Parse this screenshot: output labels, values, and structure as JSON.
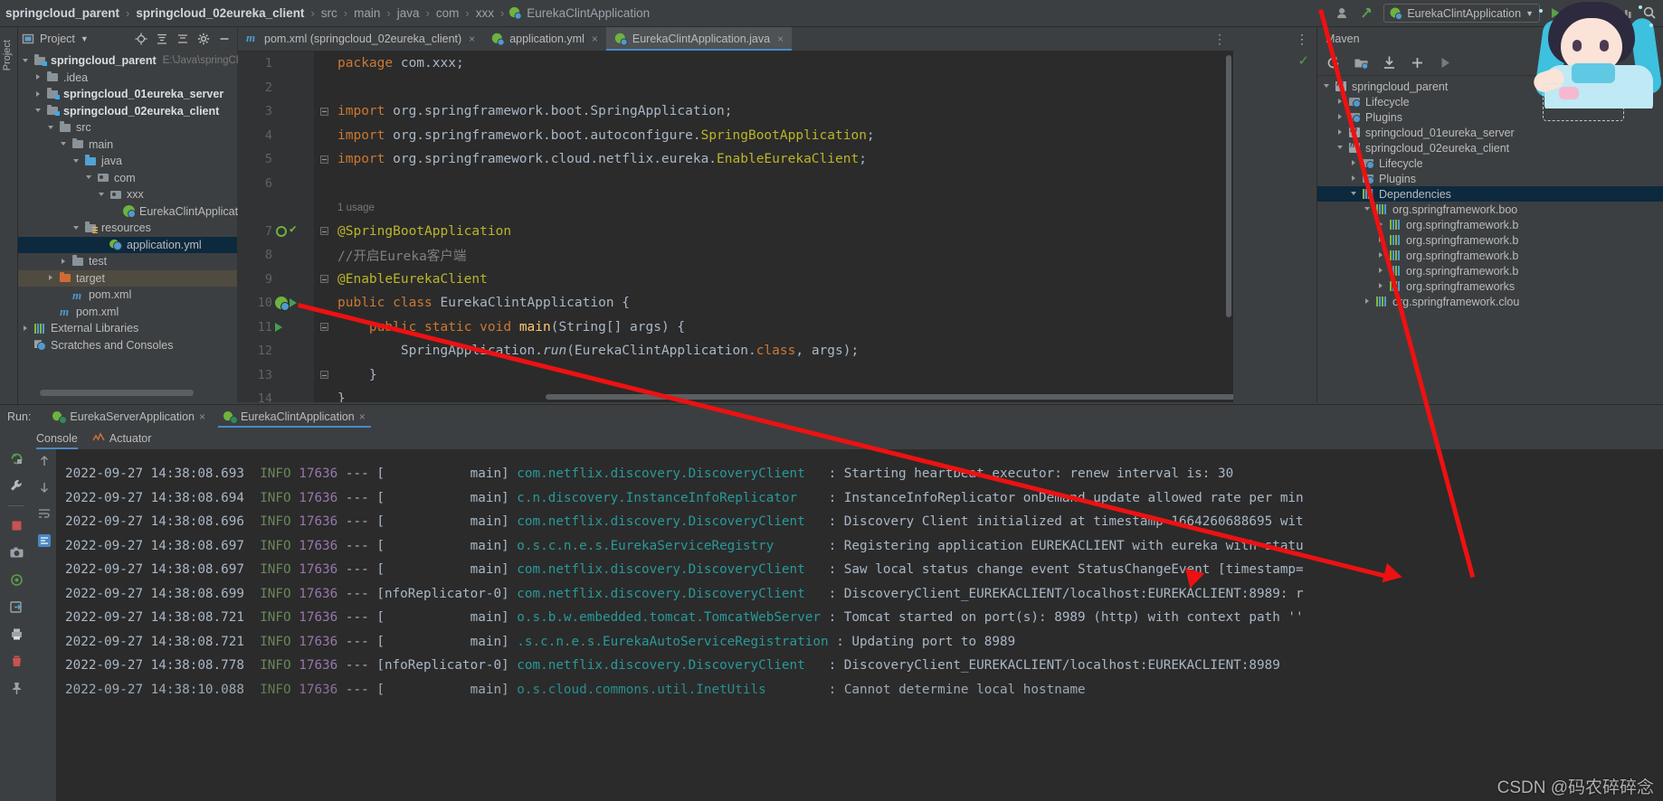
{
  "breadcrumb": {
    "items": [
      {
        "label": "springcloud_parent",
        "bold": true
      },
      {
        "label": "springcloud_02eureka_client",
        "bold": true
      },
      {
        "label": "src",
        "bold": false
      },
      {
        "label": "main",
        "bold": false
      },
      {
        "label": "java",
        "bold": false
      },
      {
        "label": "com",
        "bold": false
      },
      {
        "label": "xxx",
        "bold": false
      },
      {
        "label": "EurekaClintApplication",
        "bold": false
      }
    ],
    "separator": "›"
  },
  "toolbar": {
    "run_config_label": "EurekaClintApplication",
    "icons": [
      "account-icon",
      "dropdown-icon",
      "update-project-icon",
      "run-icon",
      "debug-icon",
      "coverage-icon",
      "profiler-icon",
      "search-icon"
    ]
  },
  "left_rail": {
    "tabs": [
      "Project"
    ]
  },
  "project_panel": {
    "title": "Project",
    "header_icons": [
      "locate-icon",
      "expand-all-icon",
      "collapse-all-icon",
      "settings-icon",
      "hide-icon"
    ],
    "tree": [
      {
        "label": "springcloud_parent",
        "indent": 0,
        "arrow": "down",
        "icon": "module-folder",
        "bold": true,
        "path": "E:\\Java\\springCloud\\s",
        "state": "none"
      },
      {
        "label": ".idea",
        "indent": 1,
        "arrow": "right",
        "icon": "folder",
        "bold": false,
        "path": "",
        "state": "none"
      },
      {
        "label": "springcloud_01eureka_server",
        "indent": 1,
        "arrow": "right",
        "icon": "module-folder",
        "bold": true,
        "path": "",
        "state": "none"
      },
      {
        "label": "springcloud_02eureka_client",
        "indent": 1,
        "arrow": "down",
        "icon": "module-folder",
        "bold": true,
        "path": "",
        "state": "none"
      },
      {
        "label": "src",
        "indent": 2,
        "arrow": "down",
        "icon": "folder",
        "bold": false,
        "path": "",
        "state": "none"
      },
      {
        "label": "main",
        "indent": 3,
        "arrow": "down",
        "icon": "folder",
        "bold": false,
        "path": "",
        "state": "none"
      },
      {
        "label": "java",
        "indent": 4,
        "arrow": "down",
        "icon": "source-folder",
        "bold": false,
        "path": "",
        "state": "none"
      },
      {
        "label": "com",
        "indent": 5,
        "arrow": "down",
        "icon": "package",
        "bold": false,
        "path": "",
        "state": "none"
      },
      {
        "label": "xxx",
        "indent": 6,
        "arrow": "down",
        "icon": "package",
        "bold": false,
        "path": "",
        "state": "none"
      },
      {
        "label": "EurekaClintApplication",
        "indent": 7,
        "arrow": "none",
        "icon": "spring-class",
        "bold": false,
        "path": "",
        "state": "none"
      },
      {
        "label": "resources",
        "indent": 4,
        "arrow": "down",
        "icon": "resource-folder",
        "bold": false,
        "path": "",
        "state": "none"
      },
      {
        "label": "application.yml",
        "indent": 6,
        "arrow": "none",
        "icon": "spring-yml",
        "bold": false,
        "path": "",
        "state": "selected-blue"
      },
      {
        "label": "test",
        "indent": 3,
        "arrow": "right",
        "icon": "folder",
        "bold": false,
        "path": "",
        "state": "none"
      },
      {
        "label": "target",
        "indent": 2,
        "arrow": "right",
        "icon": "target-folder",
        "bold": false,
        "path": "",
        "state": "selected-brown"
      },
      {
        "label": "pom.xml",
        "indent": 3,
        "arrow": "none",
        "icon": "maven-file",
        "bold": false,
        "path": "",
        "state": "none"
      },
      {
        "label": "pom.xml",
        "indent": 2,
        "arrow": "none",
        "icon": "maven-file",
        "bold": false,
        "path": "",
        "state": "none"
      },
      {
        "label": "External Libraries",
        "indent": 0,
        "arrow": "right",
        "icon": "library",
        "bold": false,
        "path": "",
        "state": "none"
      },
      {
        "label": "Scratches and Consoles",
        "indent": 0,
        "arrow": "none",
        "icon": "scratches",
        "bold": false,
        "path": "",
        "state": "none"
      }
    ]
  },
  "editor": {
    "tabs": [
      {
        "label": "pom.xml (springcloud_02eureka_client)",
        "icon": "maven-file",
        "active": false,
        "closable": true
      },
      {
        "label": "application.yml",
        "icon": "spring-yml",
        "active": false,
        "closable": true
      },
      {
        "label": "EurekaClintApplication.java",
        "icon": "spring-class",
        "active": true,
        "closable": true
      }
    ],
    "lines": [
      {
        "num": "1",
        "gutter": [],
        "fold": "none",
        "segments": [
          {
            "t": "package",
            "c": "k"
          },
          {
            "t": " com.xxx;",
            "c": "p"
          }
        ]
      },
      {
        "num": "2",
        "gutter": [],
        "fold": "none",
        "segments": []
      },
      {
        "num": "3",
        "gutter": [],
        "fold": "start",
        "segments": [
          {
            "t": "import",
            "c": "k"
          },
          {
            "t": " org.springframework.boot.SpringApplication;",
            "c": "p"
          }
        ]
      },
      {
        "num": "4",
        "gutter": [],
        "fold": "none",
        "segments": [
          {
            "t": "import",
            "c": "k"
          },
          {
            "t": " org.springframework.boot.autoconfigure.",
            "c": "p"
          },
          {
            "t": "SpringBootApplication",
            "c": "ann"
          },
          {
            "t": ";",
            "c": "p"
          }
        ]
      },
      {
        "num": "5",
        "gutter": [],
        "fold": "end",
        "segments": [
          {
            "t": "import",
            "c": "k"
          },
          {
            "t": " org.springframework.cloud.netflix.eureka.",
            "c": "p"
          },
          {
            "t": "EnableEurekaClient",
            "c": "ann"
          },
          {
            "t": ";",
            "c": "p"
          }
        ]
      },
      {
        "num": "6",
        "gutter": [],
        "fold": "none",
        "segments": []
      },
      {
        "num": "",
        "gutter": [],
        "fold": "none",
        "usage": "1 usage",
        "segments": []
      },
      {
        "num": "7",
        "gutter": [
          "search-icon",
          "check-icon"
        ],
        "fold": "start",
        "segments": [
          {
            "t": "@SpringBootApplication",
            "c": "ann"
          }
        ]
      },
      {
        "num": "8",
        "gutter": [],
        "fold": "none",
        "segments": [
          {
            "t": "//开启Eureka客户端",
            "c": "cmt"
          }
        ]
      },
      {
        "num": "9",
        "gutter": [],
        "fold": "end",
        "segments": [
          {
            "t": "@EnableEurekaClient",
            "c": "ann"
          }
        ]
      },
      {
        "num": "10",
        "gutter": [
          "spring-bean-icon",
          "run-arrow-icon"
        ],
        "fold": "none",
        "segments": [
          {
            "t": "public",
            "c": "k"
          },
          {
            "t": " ",
            "c": "p"
          },
          {
            "t": "class",
            "c": "k"
          },
          {
            "t": " EurekaClintApplication {",
            "c": "p"
          }
        ]
      },
      {
        "num": "11",
        "gutter": [
          "run-arrow-icon"
        ],
        "fold": "start",
        "segments": [
          {
            "t": "    ",
            "c": "p"
          },
          {
            "t": "public",
            "c": "k"
          },
          {
            "t": " ",
            "c": "p"
          },
          {
            "t": "static",
            "c": "k"
          },
          {
            "t": " ",
            "c": "p"
          },
          {
            "t": "void",
            "c": "k"
          },
          {
            "t": " ",
            "c": "p"
          },
          {
            "t": "main",
            "c": "fn"
          },
          {
            "t": "(String[] args) {",
            "c": "p"
          }
        ]
      },
      {
        "num": "12",
        "gutter": [],
        "fold": "none",
        "segments": [
          {
            "t": "        SpringApplication.",
            "c": "p"
          },
          {
            "t": "run",
            "c": "ital"
          },
          {
            "t": "(EurekaClintApplication.",
            "c": "p"
          },
          {
            "t": "class",
            "c": "k"
          },
          {
            "t": ", args);",
            "c": "p"
          }
        ]
      },
      {
        "num": "13",
        "gutter": [],
        "fold": "end",
        "segments": [
          {
            "t": "    }",
            "c": "p"
          }
        ]
      },
      {
        "num": "14",
        "gutter": [],
        "fold": "none",
        "segments": [
          {
            "t": "}",
            "c": "p"
          }
        ]
      }
    ]
  },
  "maven_panel": {
    "title": "Maven",
    "toolbar_icons": [
      "reload-icon",
      "add-module-icon",
      "download-sources-icon",
      "add-icon",
      "run-icon",
      "toggle-icon"
    ],
    "tree": [
      {
        "label": "springcloud_parent",
        "indent": 0,
        "arrow": "down",
        "icon": "maven-project",
        "state": "none"
      },
      {
        "label": "Lifecycle",
        "indent": 1,
        "arrow": "right",
        "icon": "phase-folder",
        "state": "none"
      },
      {
        "label": "Plugins",
        "indent": 1,
        "arrow": "right",
        "icon": "phase-folder",
        "state": "none"
      },
      {
        "label": "springcloud_01eureka_server",
        "indent": 1,
        "arrow": "right",
        "icon": "maven-project",
        "state": "none"
      },
      {
        "label": "springcloud_02eureka_client",
        "indent": 1,
        "arrow": "down",
        "icon": "maven-project",
        "state": "none"
      },
      {
        "label": "Lifecycle",
        "indent": 2,
        "arrow": "right",
        "icon": "phase-folder",
        "state": "none"
      },
      {
        "label": "Plugins",
        "indent": 2,
        "arrow": "right",
        "icon": "phase-folder",
        "state": "none"
      },
      {
        "label": "Dependencies",
        "indent": 2,
        "arrow": "down",
        "icon": "dependency",
        "state": "selected"
      },
      {
        "label": "org.springframework.boo",
        "indent": 3,
        "arrow": "down",
        "icon": "dependency",
        "state": "none"
      },
      {
        "label": "org.springframework.b",
        "indent": 4,
        "arrow": "right",
        "icon": "dependency",
        "state": "none"
      },
      {
        "label": "org.springframework.b",
        "indent": 4,
        "arrow": "right",
        "icon": "dependency",
        "state": "none"
      },
      {
        "label": "org.springframework.b",
        "indent": 4,
        "arrow": "right",
        "icon": "dependency",
        "state": "none"
      },
      {
        "label": "org.springframework.b",
        "indent": 4,
        "arrow": "right",
        "icon": "dependency",
        "state": "none"
      },
      {
        "label": "org.springframeworks",
        "indent": 4,
        "arrow": "right",
        "icon": "dependency",
        "state": "none"
      },
      {
        "label": "org.springframework.clou",
        "indent": 3,
        "arrow": "right",
        "icon": "dependency",
        "state": "none"
      }
    ]
  },
  "run_panel": {
    "run_label": "Run:",
    "tabs": [
      {
        "label": "EurekaServerApplication",
        "active": false,
        "closable": true
      },
      {
        "label": "EurekaClintApplication",
        "active": true,
        "closable": true
      }
    ],
    "sub_tabs": [
      {
        "label": "Console",
        "active": true,
        "icon": "console-icon"
      },
      {
        "label": "Actuator",
        "active": false,
        "icon": "actuator-icon"
      }
    ],
    "side_icons": [
      "rerun-icon",
      "wrench-icon",
      "stop-icon",
      "camera-icon"
    ],
    "side2_icons": [
      "up-arrow-icon",
      "down-arrow-icon",
      "soft-wrap-icon",
      "scroll-end-icon",
      "print-icon",
      "trash-icon"
    ],
    "console_lines": [
      {
        "ts": "",
        "lvl": "",
        "pid": "",
        "thread": "",
        "logger": "",
        "msg": "",
        "partial_top": true
      },
      {
        "ts": "2022-09-27 14:38:08.693",
        "lvl": "INFO",
        "pid": "17636",
        "thread": "main]",
        "logger": "com.netflix.discovery.DiscoveryClient",
        "msg": ": Starting heartbeat executor: renew interval is: 30"
      },
      {
        "ts": "2022-09-27 14:38:08.694",
        "lvl": "INFO",
        "pid": "17636",
        "thread": "main]",
        "logger": "c.n.discovery.InstanceInfoReplicator",
        "msg": ": InstanceInfoReplicator onDemand update allowed rate per min"
      },
      {
        "ts": "2022-09-27 14:38:08.696",
        "lvl": "INFO",
        "pid": "17636",
        "thread": "main]",
        "logger": "com.netflix.discovery.DiscoveryClient",
        "msg": ": Discovery Client initialized at timestamp 1664260688695 wit"
      },
      {
        "ts": "2022-09-27 14:38:08.697",
        "lvl": "INFO",
        "pid": "17636",
        "thread": "main]",
        "logger": "o.s.c.n.e.s.EurekaServiceRegistry",
        "msg": ": Registering application EUREKACLIENT with eureka with statu"
      },
      {
        "ts": "2022-09-27 14:38:08.697",
        "lvl": "INFO",
        "pid": "17636",
        "thread": "main]",
        "logger": "com.netflix.discovery.DiscoveryClient",
        "msg": ": Saw local status change event StatusChangeEvent [timestamp="
      },
      {
        "ts": "2022-09-27 14:38:08.699",
        "lvl": "INFO",
        "pid": "17636",
        "thread": "nfoReplicator-0]",
        "logger": "com.netflix.discovery.DiscoveryClient",
        "msg": ": DiscoveryClient_EUREKACLIENT/localhost:EUREKACLIENT:8989: r"
      },
      {
        "ts": "2022-09-27 14:38:08.721",
        "lvl": "INFO",
        "pid": "17636",
        "thread": "main]",
        "logger": "o.s.b.w.embedded.tomcat.TomcatWebServer",
        "msg": ": Tomcat started on port(s): 8989 (http) with context path ''"
      },
      {
        "ts": "2022-09-27 14:38:08.721",
        "lvl": "INFO",
        "pid": "17636",
        "thread": "main]",
        "logger": ".s.c.n.e.s.EurekaAutoServiceRegistration",
        "msg": ": Updating port to 8989"
      },
      {
        "ts": "2022-09-27 14:38:08.778",
        "lvl": "INFO",
        "pid": "17636",
        "thread": "nfoReplicator-0]",
        "logger": "com.netflix.discovery.DiscoveryClient",
        "msg": ": DiscoveryClient_EUREKACLIENT/localhost:EUREKACLIENT:8989"
      },
      {
        "ts": "2022-09-27 14:38:10.088",
        "lvl": "INFO",
        "pid": "17636",
        "thread": "main]",
        "logger": "o.s.cloud.commons.util.InetUtils",
        "msg": ": Cannot determine local hostname",
        "partial_bottom": true
      }
    ]
  },
  "watermark": "CSDN @码农碎碎念",
  "colors": {
    "accent_blue": "#4a88c7",
    "annotation": "#bbb529",
    "keyword": "#cc7832",
    "logger": "#299999",
    "info": "#6a8759",
    "pid": "#9876aa",
    "annotation_arrow": "#ee1111"
  }
}
